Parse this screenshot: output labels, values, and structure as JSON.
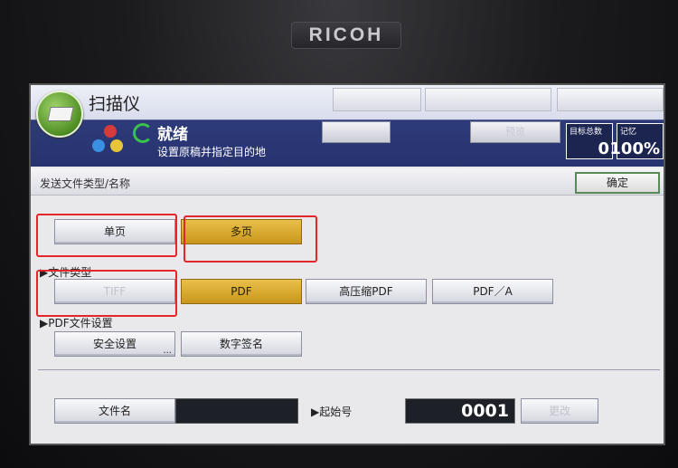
{
  "device": {
    "brand": "RICOH"
  },
  "app": {
    "title": "扫描仪",
    "logo_icon": "scanner-app-icon"
  },
  "header": {
    "top_buttons": [
      "",
      "",
      ""
    ],
    "status_title": "就绪",
    "status_subtitle": "设置原稿并指定目的地",
    "destination_button": "",
    "preview_button": "预览",
    "counter_total_label": "目标总数",
    "counter_total_value": "0",
    "counter_memory_label": "记忆",
    "counter_memory_value": "100%"
  },
  "section": {
    "title": "发送文件类型/名称",
    "ok_label": "确定"
  },
  "select_item": {
    "label": "",
    "options": [
      "单页",
      "多页"
    ],
    "selected": "多页"
  },
  "file_type": {
    "label": "▶文件类型",
    "options": [
      "TIFF",
      "PDF",
      "高压缩PDF",
      "PDF／A"
    ],
    "selected": "PDF"
  },
  "pdf_settings": {
    "label": "▶PDF文件设置",
    "security_button": "安全设置",
    "ellipsis": "...",
    "signature_button": "数字签名"
  },
  "file_name": {
    "button": "文件名",
    "value": "",
    "start_label": "▶起始号",
    "start_value": "0001",
    "change_button": "更改"
  },
  "colors": {
    "selected": "#d9a92e",
    "header_blue": "#26336f",
    "highlight_red": "#e3262b"
  }
}
